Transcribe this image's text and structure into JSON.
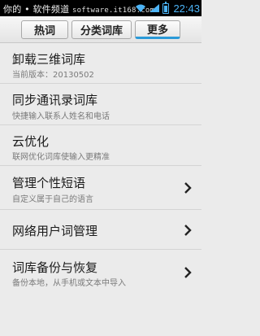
{
  "status_bar": {
    "watermark_text": "你的 • 软件频道",
    "watermark_url": "software.it168.com",
    "time": "22:43",
    "battery_level": 0.85
  },
  "tabs": [
    {
      "label": "热词",
      "selected": false
    },
    {
      "label": "分类词库",
      "selected": false
    },
    {
      "label": "更多",
      "selected": true
    }
  ],
  "items": [
    {
      "title": "卸载三维词库",
      "subtitle": "当前版本：20130502",
      "has_chevron": false
    },
    {
      "title": "同步通讯录词库",
      "subtitle": "快捷输入联系人姓名和电话",
      "has_chevron": false
    },
    {
      "title": "云优化",
      "subtitle": "联网优化词库使输入更精准",
      "has_chevron": false
    },
    {
      "title": "管理个性短语",
      "subtitle": "自定义属于自己的语言",
      "has_chevron": true
    },
    {
      "title": "网络用户词管理",
      "subtitle": "",
      "has_chevron": true
    },
    {
      "title": "词库备份与恢复",
      "subtitle": "备份本地，从手机或文本中导入",
      "has_chevron": true
    }
  ],
  "colors": {
    "accent": "#2a9ad8",
    "status_blue": "#4cb3f5"
  }
}
